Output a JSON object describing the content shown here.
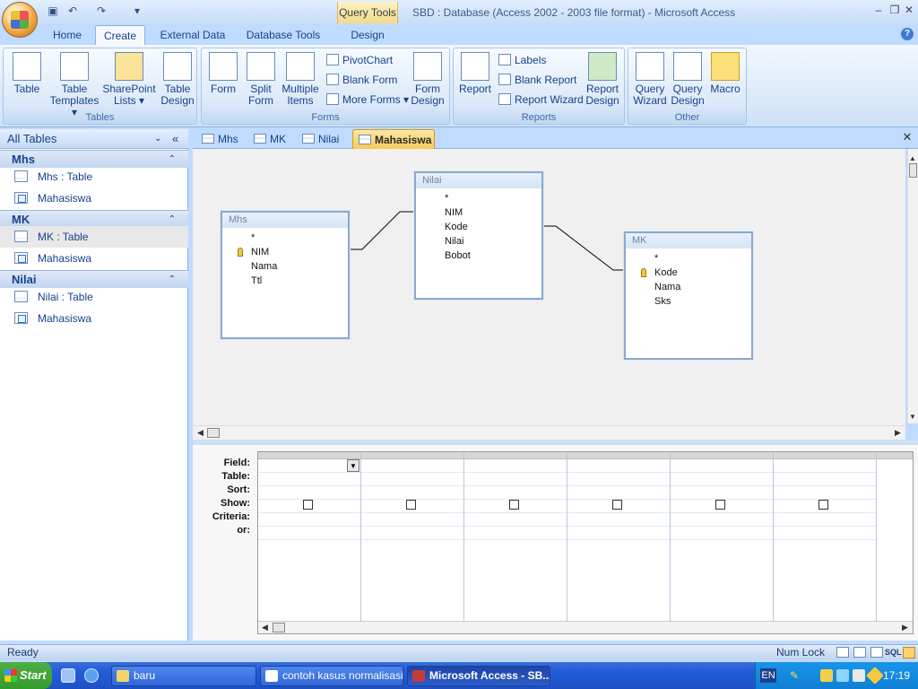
{
  "titlebar": {
    "context_tab": "Query Tools",
    "window_title": "SBD : Database (Access 2002 - 2003 file format) - Microsoft Access"
  },
  "ribbon_tabs": [
    "Home",
    "Create",
    "External Data",
    "Database Tools",
    "Design"
  ],
  "ribbon": {
    "tables": {
      "label": "Tables",
      "buttons": [
        "Table",
        "Table Templates ▾",
        "SharePoint Lists ▾",
        "Table Design"
      ]
    },
    "forms": {
      "label": "Forms",
      "form": "Form",
      "split_form": "Split Form",
      "multiple_items": "Multiple Items",
      "pivotchart": "PivotChart",
      "blank_form": "Blank Form",
      "more_forms": "More Forms ▾",
      "form_design": "Form Design"
    },
    "reports": {
      "label": "Reports",
      "report": "Report",
      "labels": "Labels",
      "blank_report": "Blank Report",
      "report_wizard": "Report Wizard",
      "report_design": "Report Design"
    },
    "other": {
      "label": "Other",
      "query_wizard": "Query Wizard",
      "query_design": "Query Design",
      "macro": "Macro"
    }
  },
  "nav": {
    "header": "All Tables",
    "groups": [
      {
        "name": "Mhs",
        "items": [
          "Mhs : Table",
          "Mahasiswa"
        ]
      },
      {
        "name": "MK",
        "items": [
          "MK : Table",
          "Mahasiswa"
        ]
      },
      {
        "name": "Nilai",
        "items": [
          "Nilai : Table",
          "Mahasiswa"
        ]
      }
    ]
  },
  "doc_tabs": [
    "Mhs",
    "MK",
    "Nilai",
    "Mahasiswa"
  ],
  "query_tables": {
    "mhs": {
      "title": "Mhs",
      "fields": [
        "*",
        "NIM",
        "Nama",
        "Ttl"
      ]
    },
    "nilai": {
      "title": "Nilai",
      "fields": [
        "*",
        "NIM",
        "Kode",
        "Nilai",
        "Bobot"
      ]
    },
    "mk": {
      "title": "MK",
      "fields": [
        "*",
        "Kode",
        "Nama",
        "Sks"
      ]
    }
  },
  "grid_rows": [
    "Field:",
    "Table:",
    "Sort:",
    "Show:",
    "Criteria:",
    "or:"
  ],
  "status": {
    "left": "Ready",
    "right": "Num Lock"
  },
  "taskbar": {
    "start": "Start",
    "tasks": [
      "baru",
      "contoh kasus normalisasi...",
      "Microsoft Access - SB..."
    ],
    "lang": "EN",
    "clock": "17:19"
  }
}
